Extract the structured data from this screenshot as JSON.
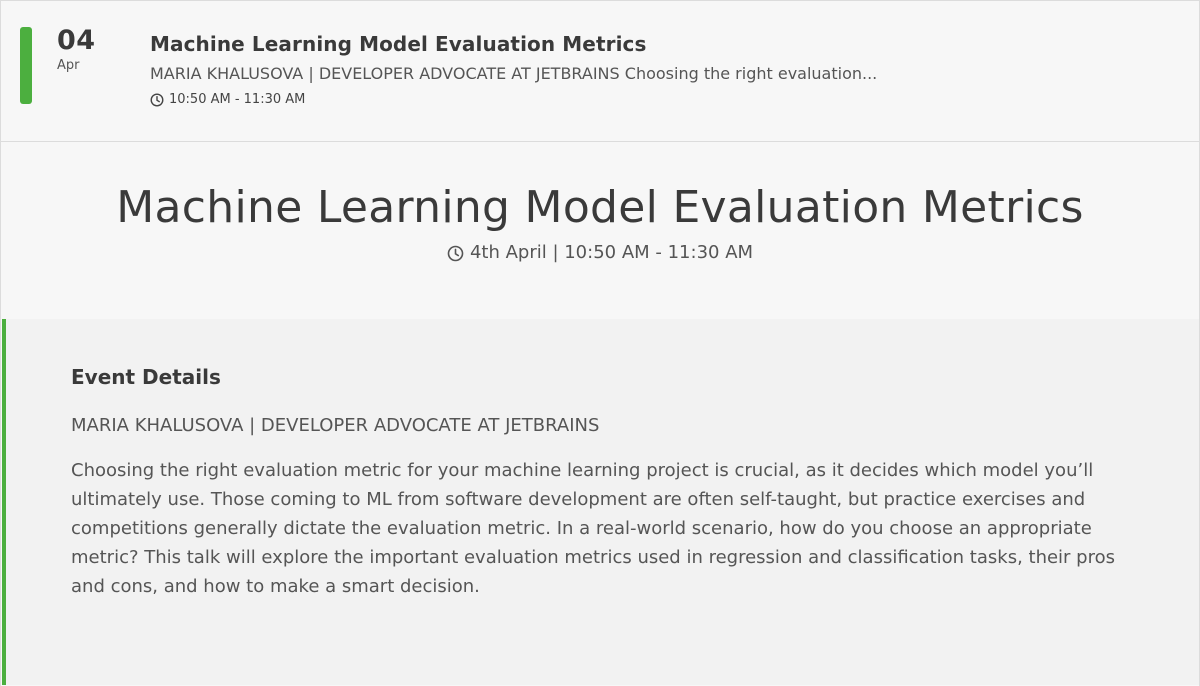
{
  "event": {
    "day": "04",
    "month": "Apr",
    "title": "Machine Learning Model Evaluation Metrics",
    "summary": "MARIA KHALUSOVA | DEVELOPER ADVOCATE AT JETBRAINS Choosing the right evaluation...",
    "time": "10:50 AM - 11:30 AM"
  },
  "detail": {
    "title": "Machine Learning Model Evaluation Metrics",
    "datetime": "4th April | 10:50 AM - 11:30 AM"
  },
  "details_panel": {
    "heading": "Event Details",
    "speaker": "MARIA KHALUSOVA | DEVELOPER ADVOCATE AT JETBRAINS",
    "description": "Choosing the right evaluation metric for your machine learning project is crucial, as it decides which model you’ll ultimately use. Those coming to ML from software development are often self-taught, but practice exercises and competitions generally dictate the evaluation metric. In a real-world scenario, how do you choose an appropriate metric? This talk will explore the important evaluation metrics used in regression and classification tasks, their pros and cons, and how to make a smart decision."
  },
  "colors": {
    "accent": "#4caf3f",
    "text": "#3a3a3a",
    "muted": "#555555",
    "background": "#f7f7f7",
    "panel": "#f2f2f2"
  },
  "icons": {
    "time": "clock-icon"
  }
}
